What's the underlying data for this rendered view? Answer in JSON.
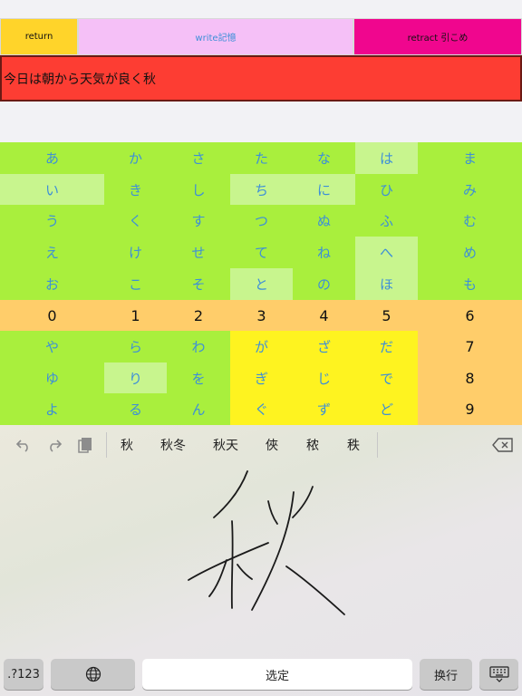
{
  "top_buttons": {
    "return_label": "return",
    "write_label": "write記憶",
    "retract_label": "retract  引こめ"
  },
  "text_field": {
    "value": "今日は朝から天気が良く秋"
  },
  "kana_grid": {
    "col1": [
      "あ",
      "い",
      "う",
      "え",
      "お",
      "0",
      "や",
      "ゆ",
      "よ"
    ],
    "col2": [
      "か",
      "き",
      "く",
      "け",
      "こ",
      "1",
      "ら",
      "り",
      "る"
    ],
    "col3": [
      "さ",
      "し",
      "す",
      "せ",
      "そ",
      "2",
      "わ",
      "を",
      "ん"
    ],
    "col4": [
      "た",
      "ち",
      "つ",
      "て",
      "と",
      "3",
      "が",
      "ぎ",
      "ぐ"
    ],
    "col5": [
      "な",
      "に",
      "ぬ",
      "ね",
      "の",
      "4",
      "ざ",
      "じ",
      "ず"
    ],
    "col6": [
      "は",
      "ひ",
      "ふ",
      "へ",
      "ほ",
      "5",
      "だ",
      "で",
      "ど"
    ],
    "col7": [
      "ま",
      "み",
      "む",
      "め",
      "も",
      "6",
      "7",
      "8",
      "9"
    ]
  },
  "colors": {
    "return_button": "#ffd42a",
    "write_button": "#f5c0f7",
    "retract_button": "#f0068e",
    "text_field": "#fd3d33",
    "kana_green": "#a9ef3d",
    "kana_highlight": "#c8f58e",
    "digit_row": "#ffcd6a",
    "voiced_yellow": "#fef320",
    "kana_text": "#3d8fd8"
  },
  "keyboard": {
    "candidates": [
      "秋",
      "秋冬",
      "秋天",
      "俠",
      "秾",
      "秩"
    ],
    "icons": {
      "undo": "undo-icon",
      "redo": "redo-icon",
      "paste": "clipboard-icon",
      "delete": "delete-icon",
      "keyboard": "keyboard-dismiss-icon",
      "globe": "globe-icon"
    },
    "bottom": {
      "symbols_label": ".?123",
      "space_label": "选定",
      "return_label": "换行"
    }
  }
}
